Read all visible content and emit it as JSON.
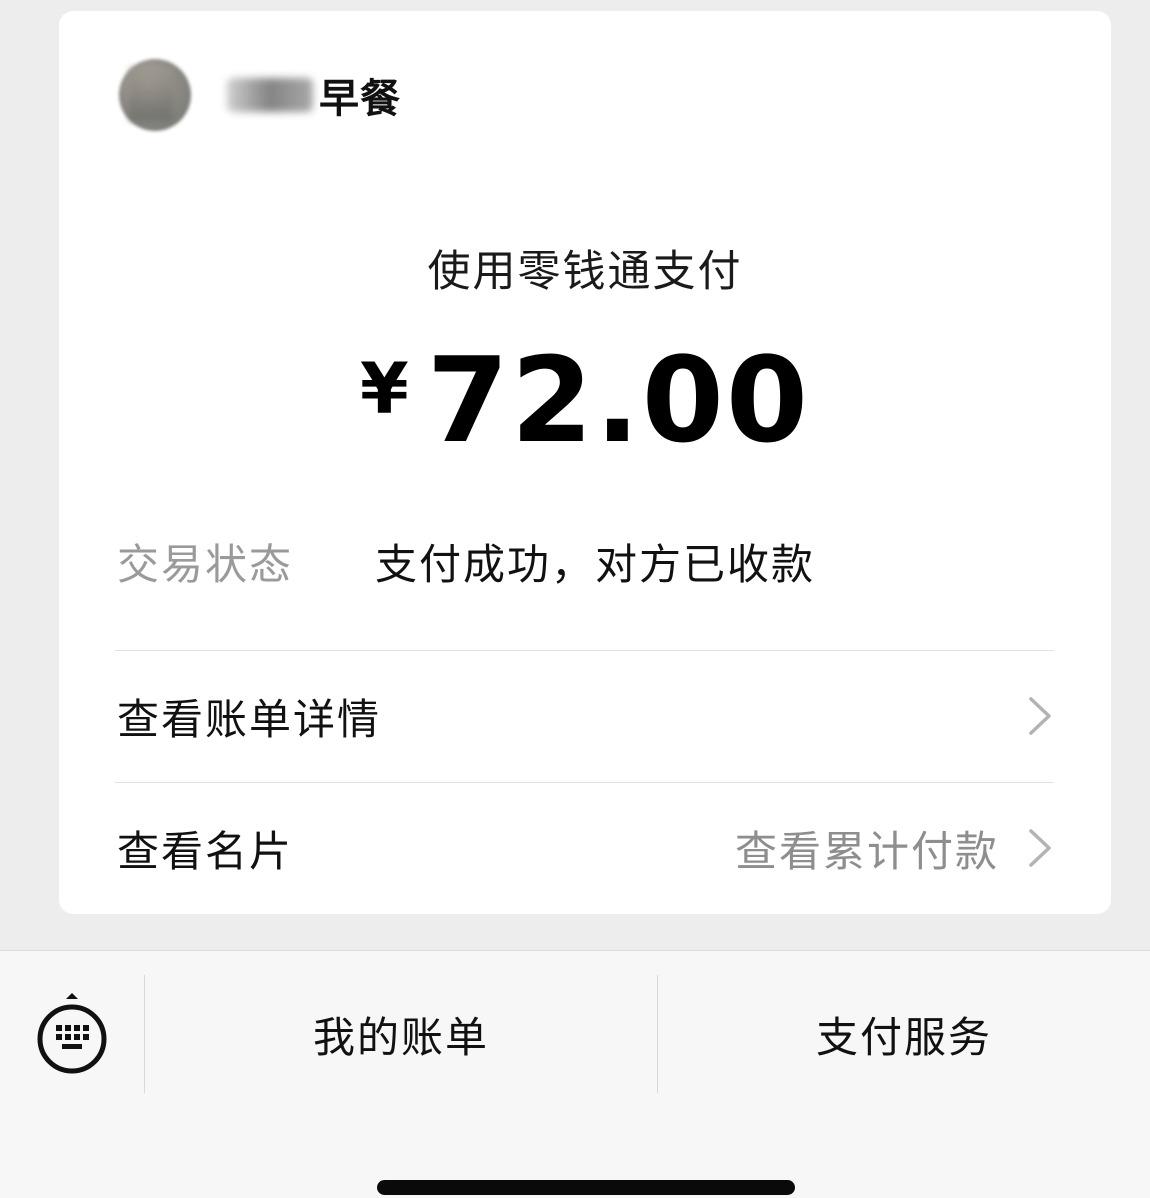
{
  "merchant": {
    "name_visible": "早餐"
  },
  "payment": {
    "method": "使用零钱通支付",
    "currency_symbol": "¥",
    "amount": "72.00"
  },
  "status": {
    "label": "交易状态",
    "value": "支付成功，对方已收款"
  },
  "rows": {
    "bill_detail": "查看账单详情",
    "business_card": "查看名片",
    "cumulative_payment": "查看累计付款"
  },
  "bottom_menu": {
    "keyboard_icon": "keyboard-icon",
    "my_bills": "我的账单",
    "pay_services": "支付服务"
  }
}
